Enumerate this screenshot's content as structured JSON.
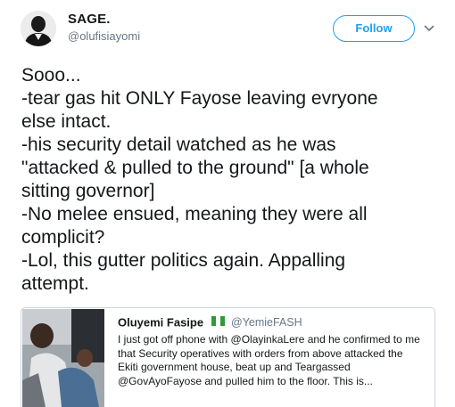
{
  "author": {
    "display_name": "SAGE.",
    "handle": "@olufisiayomi"
  },
  "actions": {
    "follow_label": "Follow",
    "menu_icon": "chevron-down-icon"
  },
  "tweet": {
    "lines": [
      "Sooo...",
      "-tear gas hit ONLY Fayose leaving evryone",
      "else intact.",
      "-his security detail watched as he was",
      "\"attacked & pulled to the ground\" [a whole",
      "sitting governor]",
      "-No melee ensued, meaning they were all",
      "complicit?",
      "-Lol, this gutter politics again. Appalling",
      "attempt."
    ]
  },
  "quoted_tweet": {
    "display_name": "Oluyemi Fasipe",
    "flag_icon": "nigeria-flag-icon",
    "handle": "@YemieFASH",
    "lines": [
      "I just got off phone with @OlayinkaLere and he confirmed to me",
      "that Security operatives with orders from above attacked the",
      "Ekiti government house, beat up and Teargassed",
      "@GovAyoFayose  and pulled him to the floor. This is..."
    ]
  },
  "colors": {
    "accent": "#1da1f2",
    "secondary_text": "#657786",
    "flag_green": "#2e9a3a"
  }
}
